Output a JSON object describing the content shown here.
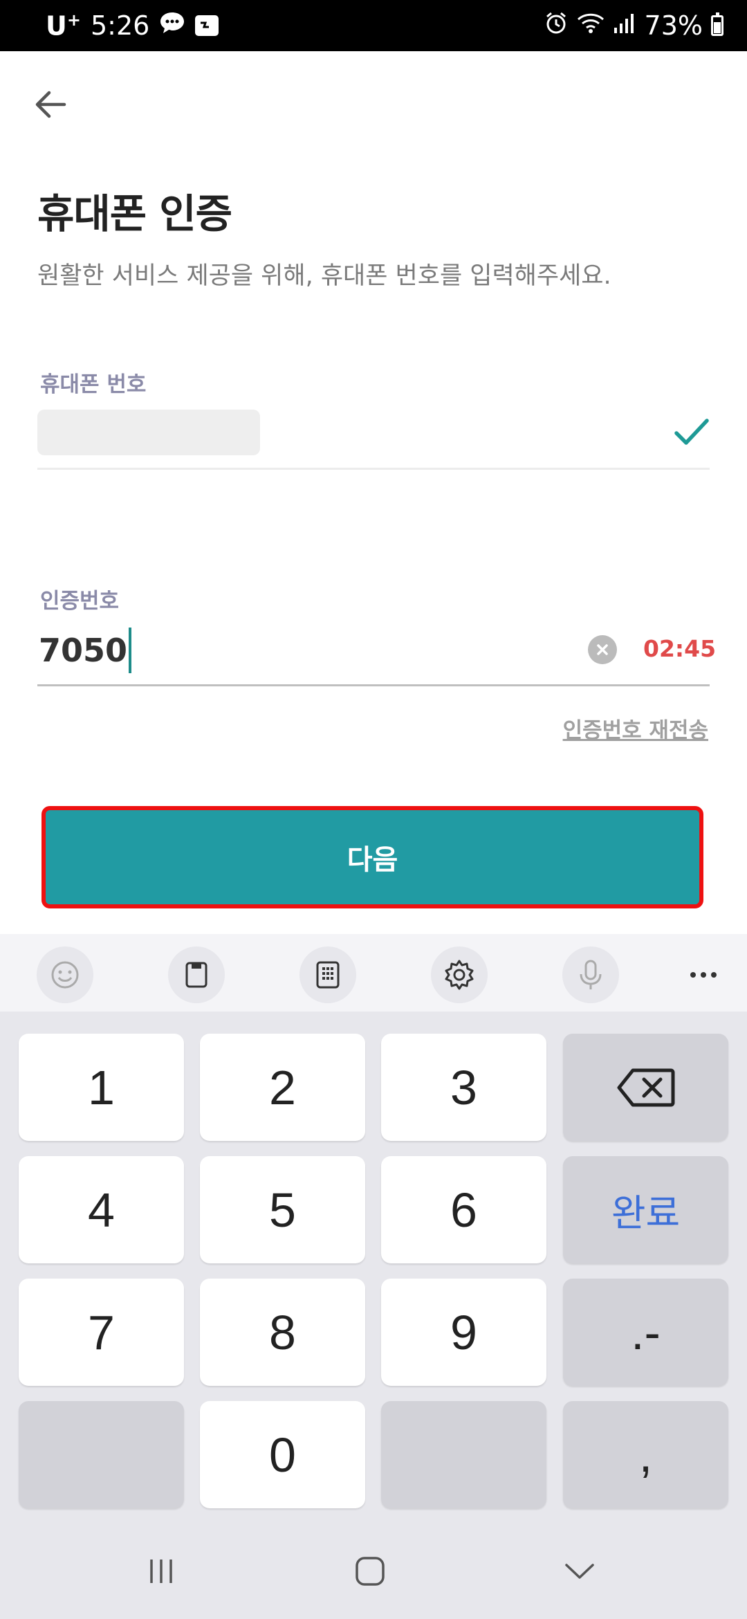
{
  "status_bar": {
    "carrier": "U",
    "carrier_sup": "+",
    "time": "5:26",
    "battery": "73%"
  },
  "header": {
    "title": "휴대폰 인증",
    "subtitle": "원활한 서비스 제공을 위해, 휴대폰 번호를 입력해주세요."
  },
  "form": {
    "phone_label": "휴대폰 번호",
    "code_label": "인증번호",
    "code_value": "7050",
    "timer": "02:45",
    "resend_label": "인증번호 재전송"
  },
  "next_button_label": "다음",
  "keyboard": {
    "rows": [
      [
        "1",
        "2",
        "3",
        "⌫"
      ],
      [
        "4",
        "5",
        "6",
        "완료"
      ],
      [
        "7",
        "8",
        "9",
        ".-"
      ],
      [
        "",
        "0",
        "",
        ","
      ]
    ],
    "toolbar_icons": [
      "emoji-icon",
      "clipboard-icon",
      "keypad-icon",
      "settings-icon",
      "mic-icon",
      "more-icon"
    ]
  },
  "colors": {
    "accent": "#219ba3",
    "timer": "#e04a4a",
    "check": "#1e9a96",
    "done_key": "#3d6fd8",
    "highlight_border": "#ee1111"
  }
}
